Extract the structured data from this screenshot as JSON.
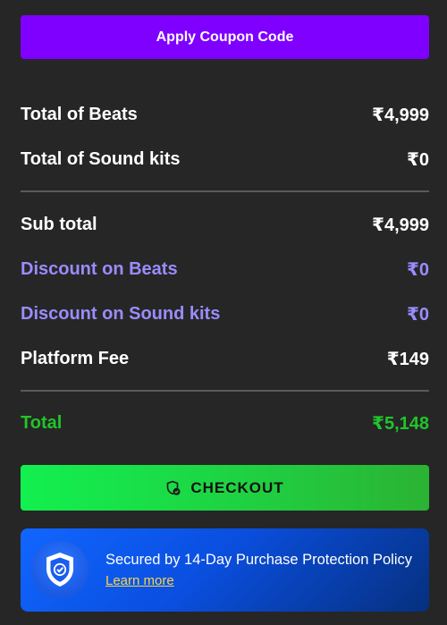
{
  "coupon": {
    "label": "Apply Coupon Code"
  },
  "summary": {
    "beats": {
      "label": "Total of Beats",
      "value": "₹4,999"
    },
    "sound_kits": {
      "label": "Total of Sound kits",
      "value": "₹0"
    },
    "sub_total": {
      "label": "Sub total",
      "value": "₹4,999"
    },
    "discount_beats": {
      "label": "Discount on Beats",
      "value": "₹0"
    },
    "discount_kits": {
      "label": "Discount on Sound kits",
      "value": "₹0"
    },
    "platform_fee": {
      "label": "Platform Fee",
      "value": "₹149"
    },
    "total": {
      "label": "Total",
      "value": "₹5,148"
    }
  },
  "checkout": {
    "label": "CHECKOUT",
    "icon": "shield-check-icon"
  },
  "protection": {
    "text": "Secured by 14-Day Purchase Protection Policy",
    "link": "Learn more",
    "icon": "shield-check-icon"
  },
  "colors": {
    "coupon_bg": "#7f00ff",
    "discount_text": "#9a8cff",
    "total_text": "#21c52a",
    "checkout_green": "#12f04f",
    "protection_blue": "#1166ff",
    "link_yellow": "#f7d64a"
  }
}
